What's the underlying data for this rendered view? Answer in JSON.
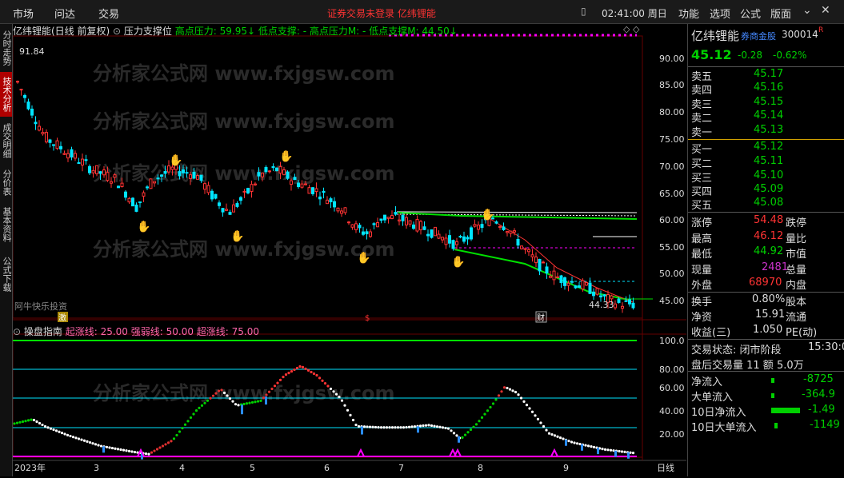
{
  "topbar": {
    "menus": [
      "市场",
      "问达",
      "交易"
    ],
    "notice": "证券交易未登录  亿纬锂能",
    "clock": "02:41:00 周日",
    "right_menus": [
      "功能",
      "选项",
      "公式",
      "版面"
    ]
  },
  "sidebar": {
    "tabs": [
      "分时走势",
      "技术分析",
      "成交明细",
      "分价表",
      "基本资料",
      "公式下载"
    ]
  },
  "chart": {
    "title_name": "亿纬锂能(日线 前复权)",
    "indicator_name": "压力支撑位",
    "indicator_values": "高点压力: 59.95↓  低点支撑: -  高点压力M: -  低点支撑M: 44.50↓",
    "price_high_label": "91.84",
    "price_low_label": "44.33",
    "price_ticks": [
      "90.00",
      "85.00",
      "80.00",
      "75.00",
      "70.00",
      "65.00",
      "60.00",
      "55.00",
      "50.00",
      "45.00"
    ],
    "watermark": "分析家公式网 www.fxjgsw.com",
    "author": "阿牛快乐投资",
    "event_tags": [
      "激",
      "$",
      "财"
    ]
  },
  "subchart": {
    "name": "操盘指南",
    "params": "起涨线: 25.00  强弱线: 50.00  超涨线: 75.00",
    "ticks": [
      "100.0",
      "80.00",
      "60.00",
      "40.00",
      "20.00"
    ]
  },
  "xaxis": {
    "labels": [
      "2023年",
      "3",
      "4",
      "5",
      "6",
      "7",
      "8",
      "9"
    ],
    "period": "日线"
  },
  "quote": {
    "name": "亿纬锂能",
    "tag": "券商金股",
    "code": "300014",
    "price": "45.12",
    "change": "-0.28",
    "pct": "-0.62%",
    "asks": [
      {
        "label": "卖五",
        "price": "45.17"
      },
      {
        "label": "卖四",
        "price": "45.16"
      },
      {
        "label": "卖三",
        "price": "45.15"
      },
      {
        "label": "卖二",
        "price": "45.14"
      },
      {
        "label": "卖一",
        "price": "45.13"
      }
    ],
    "bids": [
      {
        "label": "买一",
        "price": "45.12"
      },
      {
        "label": "买二",
        "price": "45.11"
      },
      {
        "label": "买三",
        "price": "45.10"
      },
      {
        "label": "买四",
        "price": "45.09"
      },
      {
        "label": "买五",
        "price": "45.08"
      }
    ],
    "stats": [
      {
        "l1": "涨停",
        "v1": "54.48",
        "c1": "#ff3333",
        "l2": "跌停"
      },
      {
        "l1": "最高",
        "v1": "46.12",
        "c1": "#ff3333",
        "l2": "量比"
      },
      {
        "l1": "最低",
        "v1": "44.92",
        "c1": "#00d000",
        "l2": "市值"
      },
      {
        "l1": "现量",
        "v1": "2481",
        "c1": "#cc33cc",
        "l2": "总量"
      },
      {
        "l1": "外盘",
        "v1": "68970",
        "c1": "#ff3333",
        "l2": "内盘"
      }
    ],
    "fin": [
      {
        "l1": "换手",
        "v1": "0.80%",
        "l2": "股本"
      },
      {
        "l1": "净资",
        "v1": "15.91",
        "l2": "流通"
      },
      {
        "l1": "收益(三)",
        "v1": "1.050",
        "l2": "PE(动)"
      }
    ],
    "trade_state": "交易状态: 闭市阶段",
    "trade_time": "15:30:0",
    "after_hours": "盘后交易量 11 额 5.0万",
    "flows": [
      {
        "label": "净流入",
        "value": "-8725"
      },
      {
        "label": "大单流入",
        "value": "-364.9"
      },
      {
        "label": "10日净流入",
        "value": "-1.49"
      },
      {
        "label": "10日大单流入",
        "value": "-1149"
      }
    ]
  },
  "colors": {
    "up": "#ff3333",
    "down": "#00e5ff",
    "green": "#00d000",
    "magenta": "#ff00ff"
  }
}
